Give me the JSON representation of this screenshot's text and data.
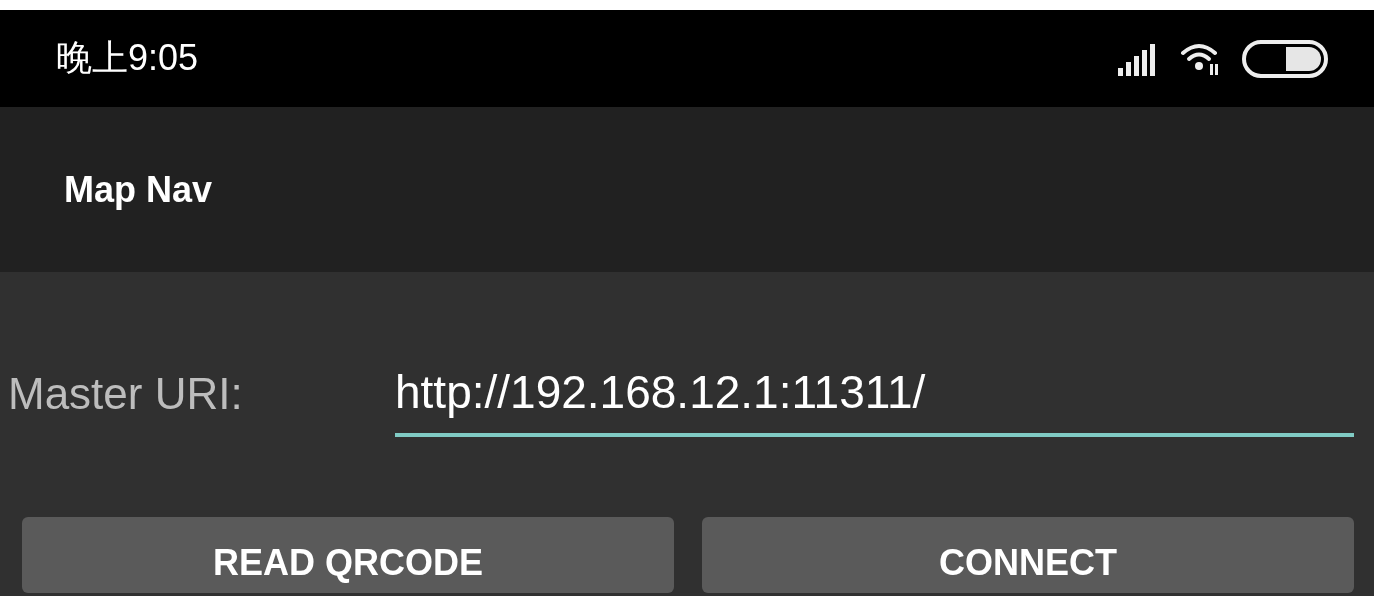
{
  "status_bar": {
    "time": "晚上9:05"
  },
  "app_bar": {
    "title": "Map Nav"
  },
  "master_uri": {
    "label": "Master URI:",
    "value": "http://192.168.12.1:11311/"
  },
  "buttons": [
    "READ QRCODE",
    "CONNECT"
  ]
}
